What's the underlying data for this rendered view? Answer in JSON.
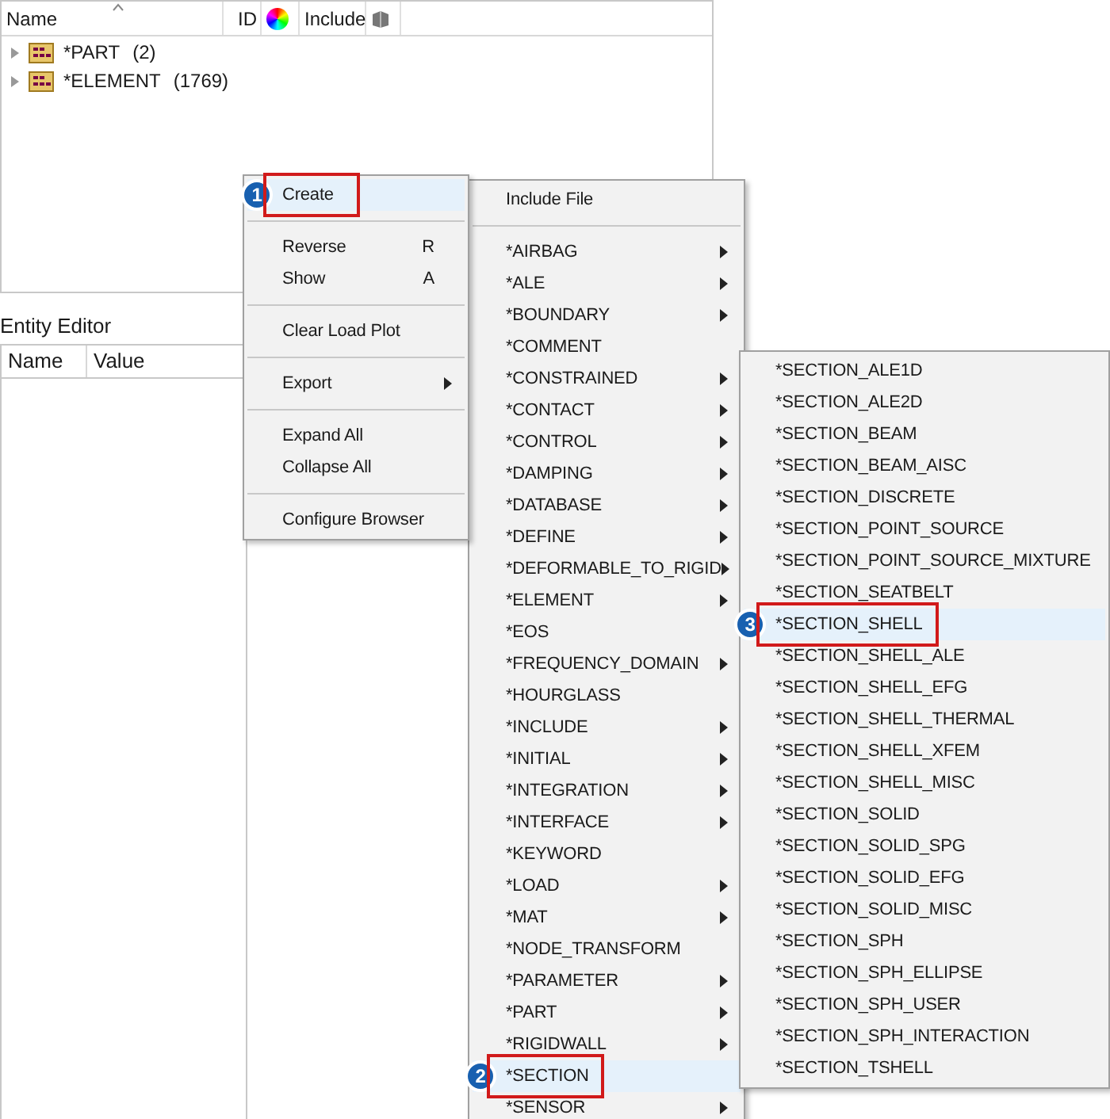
{
  "browser": {
    "columns": [
      {
        "label": "Name",
        "sorted": true
      },
      {
        "label": "ID",
        "sorted": false
      },
      {
        "kind": "color-icon"
      },
      {
        "label": "Include",
        "sorted": false
      },
      {
        "kind": "cube-icon"
      }
    ],
    "rows": [
      {
        "label": "*PART",
        "count": "(2)",
        "expanded": false
      },
      {
        "label": "*ELEMENT",
        "count": "(1769)",
        "expanded": false
      }
    ]
  },
  "entity_editor": {
    "title": "Entity Editor",
    "columns": [
      "Name",
      "Value"
    ]
  },
  "context_menu": {
    "groups": [
      [
        {
          "label": "Create",
          "selected": true,
          "submenu": false,
          "callout": "1"
        }
      ],
      [
        {
          "label": "Reverse",
          "shortcut": "R",
          "selected": false,
          "submenu": false
        },
        {
          "label": "Show",
          "shortcut": "A",
          "selected": false,
          "submenu": false
        }
      ],
      [
        {
          "label": "Clear Load Plot",
          "selected": false,
          "submenu": false
        }
      ],
      [
        {
          "label": "Export",
          "selected": false,
          "submenu": true
        }
      ],
      [
        {
          "label": "Expand All",
          "selected": false,
          "submenu": false
        },
        {
          "label": "Collapse All",
          "selected": false,
          "submenu": false
        }
      ],
      [
        {
          "label": "Configure Browser",
          "selected": false,
          "submenu": false
        }
      ]
    ]
  },
  "create_menu": {
    "groups": [
      [
        {
          "label": "Include File",
          "selected": false,
          "submenu": false
        }
      ],
      [
        {
          "label": "*AIRBAG",
          "selected": false,
          "submenu": true
        },
        {
          "label": "*ALE",
          "selected": false,
          "submenu": true
        },
        {
          "label": "*BOUNDARY",
          "selected": false,
          "submenu": true
        },
        {
          "label": "*COMMENT",
          "selected": false,
          "submenu": false
        },
        {
          "label": "*CONSTRAINED",
          "selected": false,
          "submenu": true
        },
        {
          "label": "*CONTACT",
          "selected": false,
          "submenu": true
        },
        {
          "label": "*CONTROL",
          "selected": false,
          "submenu": true
        },
        {
          "label": "*DAMPING",
          "selected": false,
          "submenu": true
        },
        {
          "label": "*DATABASE",
          "selected": false,
          "submenu": true
        },
        {
          "label": "*DEFINE",
          "selected": false,
          "submenu": true
        },
        {
          "label": "*DEFORMABLE_TO_RIGID",
          "selected": false,
          "submenu": true
        },
        {
          "label": "*ELEMENT",
          "selected": false,
          "submenu": true
        },
        {
          "label": "*EOS",
          "selected": false,
          "submenu": false
        },
        {
          "label": "*FREQUENCY_DOMAIN",
          "selected": false,
          "submenu": true
        },
        {
          "label": "*HOURGLASS",
          "selected": false,
          "submenu": false
        },
        {
          "label": "*INCLUDE",
          "selected": false,
          "submenu": true
        },
        {
          "label": "*INITIAL",
          "selected": false,
          "submenu": true
        },
        {
          "label": "*INTEGRATION",
          "selected": false,
          "submenu": true
        },
        {
          "label": "*INTERFACE",
          "selected": false,
          "submenu": true
        },
        {
          "label": "*KEYWORD",
          "selected": false,
          "submenu": false
        },
        {
          "label": "*LOAD",
          "selected": false,
          "submenu": true
        },
        {
          "label": "*MAT",
          "selected": false,
          "submenu": true
        },
        {
          "label": "*NODE_TRANSFORM",
          "selected": false,
          "submenu": false
        },
        {
          "label": "*PARAMETER",
          "selected": false,
          "submenu": true
        },
        {
          "label": "*PART",
          "selected": false,
          "submenu": true
        },
        {
          "label": "*RIGIDWALL",
          "selected": false,
          "submenu": true
        },
        {
          "label": "*SECTION",
          "selected": true,
          "submenu": false,
          "callout": "2"
        },
        {
          "label": "*SENSOR",
          "selected": false,
          "submenu": true
        }
      ]
    ]
  },
  "section_menu": {
    "groups": [
      [
        {
          "label": "*SECTION_ALE1D",
          "selected": false
        },
        {
          "label": "*SECTION_ALE2D",
          "selected": false
        },
        {
          "label": "*SECTION_BEAM",
          "selected": false
        },
        {
          "label": "*SECTION_BEAM_AISC",
          "selected": false
        },
        {
          "label": "*SECTION_DISCRETE",
          "selected": false
        },
        {
          "label": "*SECTION_POINT_SOURCE",
          "selected": false
        },
        {
          "label": "*SECTION_POINT_SOURCE_MIXTURE",
          "selected": false
        },
        {
          "label": "*SECTION_SEATBELT",
          "selected": false
        },
        {
          "label": "*SECTION_SHELL",
          "selected": true,
          "callout": "3"
        },
        {
          "label": "*SECTION_SHELL_ALE",
          "selected": false
        },
        {
          "label": "*SECTION_SHELL_EFG",
          "selected": false
        },
        {
          "label": "*SECTION_SHELL_THERMAL",
          "selected": false
        },
        {
          "label": "*SECTION_SHELL_XFEM",
          "selected": false
        },
        {
          "label": "*SECTION_SHELL_MISC",
          "selected": false
        },
        {
          "label": "*SECTION_SOLID",
          "selected": false
        },
        {
          "label": "*SECTION_SOLID_SPG",
          "selected": false
        },
        {
          "label": "*SECTION_SOLID_EFG",
          "selected": false
        },
        {
          "label": "*SECTION_SOLID_MISC",
          "selected": false
        },
        {
          "label": "*SECTION_SPH",
          "selected": false
        },
        {
          "label": "*SECTION_SPH_ELLIPSE",
          "selected": false
        },
        {
          "label": "*SECTION_SPH_USER",
          "selected": false
        },
        {
          "label": "*SECTION_SPH_INTERACTION",
          "selected": false
        },
        {
          "label": "*SECTION_TSHELL",
          "selected": false
        }
      ]
    ]
  }
}
